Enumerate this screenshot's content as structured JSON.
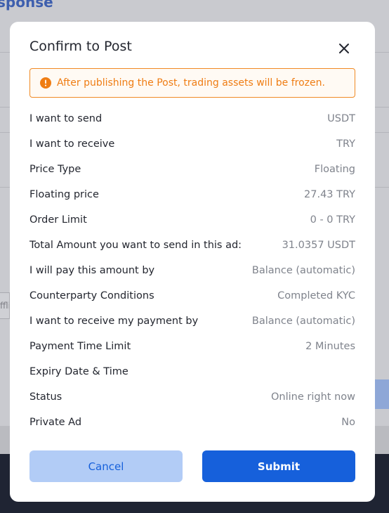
{
  "background": {
    "heading": "sponse",
    "input_stub": "ffli"
  },
  "modal": {
    "title": "Confirm to Post",
    "alert": {
      "icon": "warning-circle-icon",
      "text": "After publishing the Post, trading assets will be frozen."
    },
    "rows": [
      {
        "label": "I want to send",
        "value": "USDT"
      },
      {
        "label": "I want to receive",
        "value": "TRY"
      },
      {
        "label": "Price Type",
        "value": "Floating"
      },
      {
        "label": "Floating price",
        "value": "27.43 TRY"
      },
      {
        "label": "Order Limit",
        "value": "0 - 0 TRY"
      },
      {
        "label": "Total Amount you want to send in this ad:",
        "value": "31.0357 USDT"
      },
      {
        "label": "I will pay this amount by",
        "value": "Balance (automatic)"
      },
      {
        "label": "Counterparty Conditions",
        "value": "Completed KYC"
      },
      {
        "label": "I want to receive my payment by",
        "value": "Balance (automatic)"
      },
      {
        "label": "Payment Time Limit",
        "value": "2 Minutes"
      },
      {
        "label": "Expiry Date & Time",
        "value": ""
      },
      {
        "label": "Status",
        "value": "Online right now"
      },
      {
        "label": "Private Ad",
        "value": "No"
      }
    ],
    "cancel_label": "Cancel",
    "submit_label": "Submit"
  },
  "colors": {
    "primary": "#1660db",
    "primary_light": "#b2ccf6",
    "warning": "#ef7d14",
    "overlay_bg": "#c9cacf",
    "footer_bg": "#1f2433"
  }
}
